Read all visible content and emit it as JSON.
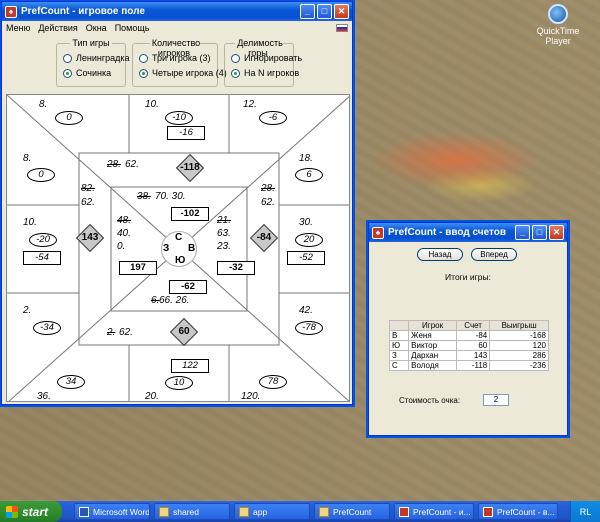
{
  "desktop": {
    "quicktime_label_1": "QuickTime",
    "quicktime_label_2": "Player"
  },
  "main_window": {
    "title": "PrefCount - игровое поле",
    "menu": [
      "Меню",
      "Действия",
      "Окна",
      "Помощь"
    ],
    "game_type": {
      "title": "Тип игры",
      "options": [
        "Ленинградка",
        "Сочинка"
      ],
      "selected": 1
    },
    "players_count": {
      "title": "Количество игроков",
      "options": [
        "Три игрока (3)",
        "Четыре игрока (4)"
      ],
      "selected": 1
    },
    "mountain_divisibility": {
      "title": "Делимость горы",
      "options": [
        "Игнорировать",
        "На N игроков"
      ],
      "selected": 1
    }
  },
  "board": {
    "top": {
      "left_num": "8.",
      "left_ell": "0",
      "mid_num": "10.",
      "mid_ell": "-10",
      "mid_rect": "-16",
      "right_num": "12.",
      "right_ell": "-6"
    },
    "left": {
      "top_num": "8.",
      "top_ell": "0",
      "mid_num": "10.",
      "mid_ell": "-20",
      "mid_rect": "-54",
      "bot_num": "2.",
      "bot_ell": "-34"
    },
    "right": {
      "top_num": "18.",
      "top_ell": "6",
      "mid_num": "30.",
      "mid_ell": "20",
      "mid_rect": "-52",
      "bot_num": "42.",
      "bot_ell": "-78"
    },
    "bottom": {
      "left_ell": "34",
      "left_num": "36.",
      "mid_rect": "122",
      "mid_ell": "10",
      "mid_num": "20.",
      "right_ell": "78",
      "right_num": "120."
    },
    "north_pool": {
      "strike": "28.",
      "rest": "62.",
      "diamond": "-118"
    },
    "west_pool": {
      "strike": "82.",
      "rest": "62.",
      "diamond": "143"
    },
    "east_pool": {
      "strike": "28.",
      "rest": "62.",
      "diamond": "-84"
    },
    "south_pool": {
      "strike": "2.",
      "rest": "62.",
      "diamond": "60"
    },
    "inner_north": {
      "strike": "38.",
      "rest": "70. 30.",
      "rect": "-102"
    },
    "inner_west": {
      "strike": "48.",
      "line2": "40.",
      "line3": "0.",
      "rect": "197"
    },
    "inner_east": {
      "strike": "21.",
      "line2": "63.",
      "line3": "23.",
      "rect": "-32"
    },
    "inner_south": {
      "strike": "6.",
      "rest": "66. 26.",
      "rect": "-62"
    },
    "directions": {
      "north": "С",
      "west": "З",
      "east": "В",
      "south": "Ю"
    }
  },
  "score_window": {
    "title": "PrefCount - ввод счетов",
    "back_btn": "Назад",
    "forward_btn": "Вперед",
    "results_label": "Итоги игры:",
    "columns": [
      "",
      "Игрок",
      "Счет",
      "Выигрыш"
    ],
    "rows": [
      [
        "В",
        "Женя",
        "-84",
        "-168"
      ],
      [
        "Ю",
        "Виктор",
        "60",
        "120"
      ],
      [
        "З",
        "Дархан",
        "143",
        "286"
      ],
      [
        "С",
        "Володя",
        "-118",
        "-236"
      ]
    ],
    "cost_label": "Стоимость очка:",
    "cost_value": "2"
  },
  "taskbar": {
    "start": "start",
    "tasks": [
      "Microsoft Word",
      "shared",
      "app",
      "PrefCount",
      "PrefCount - и...",
      "PrefCount - в..."
    ],
    "tray": "RL"
  }
}
